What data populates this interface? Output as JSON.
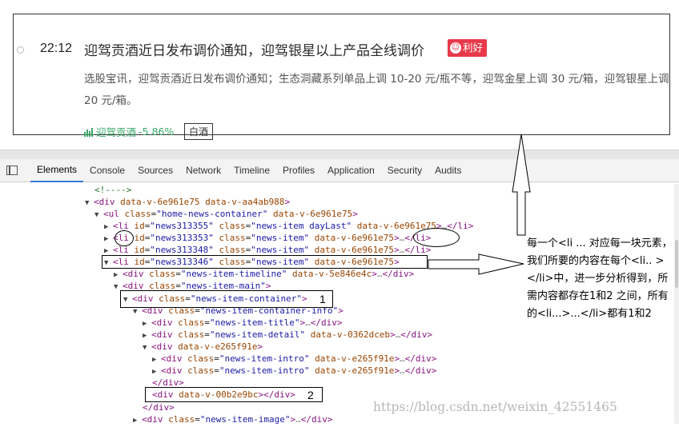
{
  "news": {
    "time": "22:12",
    "title": "迎驾贡酒近日发布调价通知，迎驾银星以上产品全线调价",
    "badge": "利好",
    "intro": "选股宝讯，迎驾贡酒近日发布调价通知；生态洞藏系列单品上调 10-20 元/瓶不等，迎驾金星上调 30 元/箱，迎驾银星上调 20 元/箱。",
    "stock_name": "迎驾贡酒",
    "stock_change": "-5.86%",
    "tag": "白酒",
    "accent_color": "#e8394a",
    "stock_color": "#3aa86a"
  },
  "devtools": {
    "tabs": [
      "Elements",
      "Console",
      "Sources",
      "Network",
      "Timeline",
      "Profiles",
      "Application",
      "Security",
      "Audits"
    ],
    "active_tab": "Elements"
  },
  "tree": {
    "r0": "<!---->",
    "r1_tag": "div",
    "r1_a1": "data-v-6e961e75",
    "r1_a2": "data-v-aa4ab988",
    "r2_tag": "ul",
    "r2_attr": "class",
    "r2_val": "\"home-news-container\"",
    "r2_a2": "data-v-6e961e75",
    "r3_id": "\"news313355\"",
    "r3_class": "\"news-item dayLast\"",
    "r3_dv": "data-v-6e961e75",
    "r4_id": "\"news313353\"",
    "r4_class": "\"news-item\"",
    "r4_dv": "data-v-6e961e75",
    "r5_id": "\"news313348\"",
    "r5_class": "\"news-item\"",
    "r5_dv": "data-v-6e961e75",
    "r6_id": "\"news313346\"",
    "r6_class": "\"news-item\"",
    "r6_dv": "data-v-6e961e75",
    "r7_class": "\"news-item-timeline\"",
    "r7_dv": "data-v-5e846e4c",
    "r8_class": "\"news-item-main\"",
    "r9_class": "\"news-item-container\"",
    "r10_class": "\"news-item-container-info\"",
    "r11_class": "\"news-item-title\"",
    "r12_class": "\"news-item-detail\"",
    "r12_dv": "data-v-0362dceb",
    "r13_dv": "data-v-e265f91e",
    "r14_class": "\"news-item-intro\"",
    "r14_dv": "data-v-e265f91e",
    "r15_class": "\"news-item-intro\"",
    "r15_dv": "data-v-e265f91e",
    "r17_dv": "data-v-00b2e9bc",
    "r19_class": "\"news-item-image\"",
    "kw_id": "id",
    "kw_class": "class",
    "t_li": "li",
    "t_div": "div",
    "t_ul": "ul",
    "ellipsis": "…",
    "close_li": "</li>",
    "close_div": "</div>",
    "close_div_tag": "/div"
  },
  "annotations": {
    "label_1": "1",
    "label_2": "2",
    "note": "每一个<li ...    对应每一块元素，我们所要的内容在每个<li..  ></li>中，进一步分析得到，所需内容都存在1和2 之间，所有的<li...>...</li>都有1和2"
  },
  "watermark": "https://blog.csdn.net/weixin_42551465"
}
